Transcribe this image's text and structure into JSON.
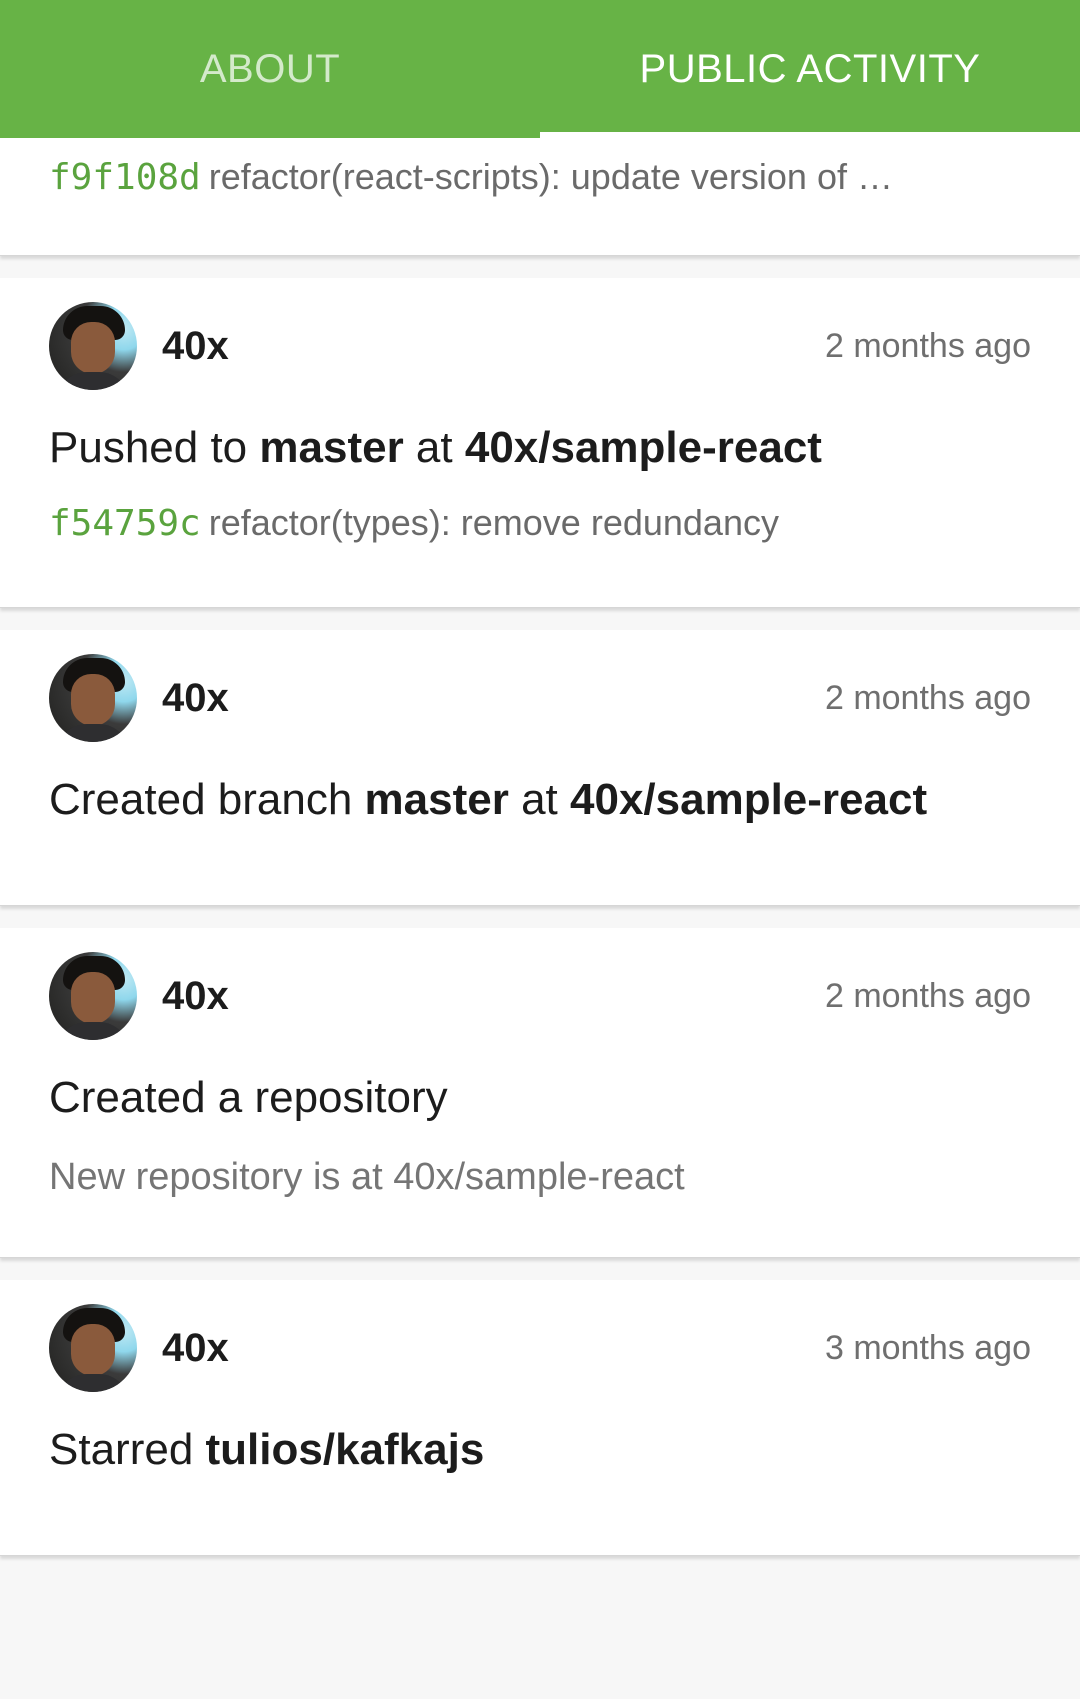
{
  "tabs": {
    "about": "ABOUT",
    "public_activity": "PUBLIC ACTIVITY",
    "active": "public_activity"
  },
  "colors": {
    "app_bar": "#67b346",
    "sha": "#5aa33e"
  },
  "partial_event": {
    "sha": "f9f108d",
    "message": "refactor(react-scripts): update version of …"
  },
  "events": [
    {
      "author": "40x",
      "time": "2 months ago",
      "title_prefix": "Pushed to ",
      "title_bold1": "master",
      "title_mid": " at ",
      "title_bold2": "40x/sample-react",
      "commit_sha": "f54759c",
      "commit_message": "refactor(types): remove redundancy"
    },
    {
      "author": "40x",
      "time": "2 months ago",
      "title_prefix": "Created branch ",
      "title_bold1": "master",
      "title_mid": " at ",
      "title_bold2": "40x/sample-react"
    },
    {
      "author": "40x",
      "time": "2 months ago",
      "title": "Created a repository",
      "subtitle": "New repository is at 40x/sample-react"
    },
    {
      "author": "40x",
      "time": "3 months ago",
      "title_prefix": "Starred ",
      "title_bold1": "tulios/kafkajs"
    }
  ]
}
